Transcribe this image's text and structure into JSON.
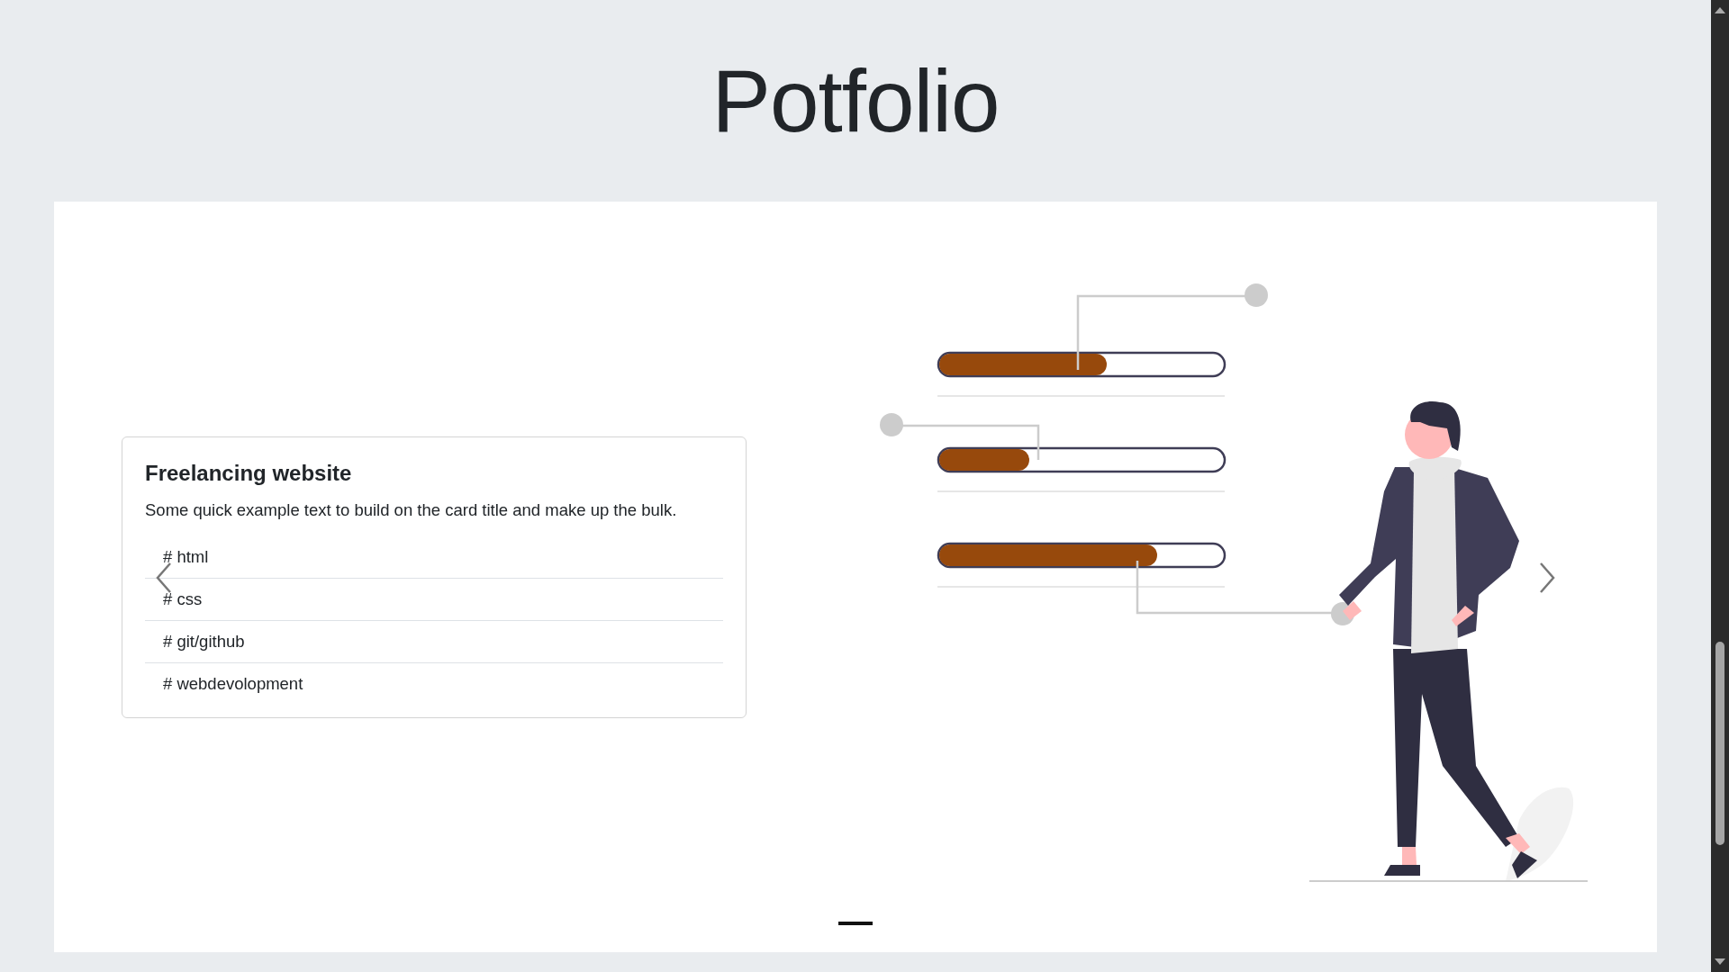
{
  "header": {
    "title": "Potfolio"
  },
  "carousel": {
    "slides": [
      {
        "card": {
          "title": "Freelancing website",
          "text": "Some quick example text to build on the card title and make up the bulk.",
          "tags": [
            "# html",
            "# css",
            "# git/github",
            "# webdevolopment"
          ]
        }
      }
    ],
    "indicators": [
      {
        "selected": true
      }
    ]
  }
}
